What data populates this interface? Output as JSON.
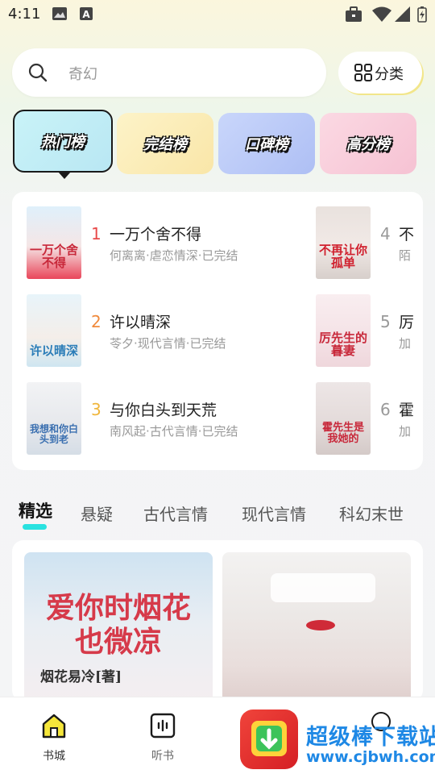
{
  "status_bar": {
    "time": "4:11"
  },
  "search": {
    "placeholder": "奇幻",
    "category_label": "分类"
  },
  "rank_tabs": [
    {
      "label": "热门榜",
      "active": true
    },
    {
      "label": "完结榜",
      "active": false
    },
    {
      "label": "口碑榜",
      "active": false
    },
    {
      "label": "高分榜",
      "active": false
    }
  ],
  "rank_list": [
    {
      "rank": "1",
      "title": "一万个舍不得",
      "meta": "何离离·虐恋情深·已完结",
      "cover_text": "一万个舍不得",
      "rank_color": "#e84a4a"
    },
    {
      "rank": "2",
      "title": "许以晴深",
      "meta": "苓夕·现代言情·已完结",
      "cover_text": "许以晴深",
      "rank_color": "#f08a3c"
    },
    {
      "rank": "3",
      "title": "与你白头到天荒",
      "meta": "南风起·古代言情·已完结",
      "cover_text": "我想和你白头到老",
      "rank_color": "#f0b63c"
    },
    {
      "rank": "4",
      "title": "不",
      "meta": "陌",
      "cover_text": "不再让你孤单",
      "rank_color": "#999999"
    },
    {
      "rank": "5",
      "title": "厉",
      "meta": "加",
      "cover_text": "厉先生的暮妻",
      "rank_color": "#999999"
    },
    {
      "rank": "6",
      "title": "霍",
      "meta": "加",
      "cover_text": "霍先生是我她的",
      "rank_color": "#999999"
    }
  ],
  "genre_tabs": [
    "精选",
    "悬疑",
    "古代言情",
    "现代言情",
    "科幻末世"
  ],
  "featured": [
    {
      "title": "爱你时烟花也微凉",
      "author": "烟花易冷[著]"
    },
    {
      "title": ""
    }
  ],
  "bottom_nav": [
    {
      "label": "书城",
      "active": true
    },
    {
      "label": "听书",
      "active": false
    }
  ],
  "watermark": {
    "line1": "超级棒下载站",
    "line2": "www.cjbwh.com"
  },
  "colors": {
    "accent": "#29e2e0",
    "rank1": "#e84a4a",
    "rank2": "#f08a3c",
    "rank3": "#f0b63c"
  }
}
